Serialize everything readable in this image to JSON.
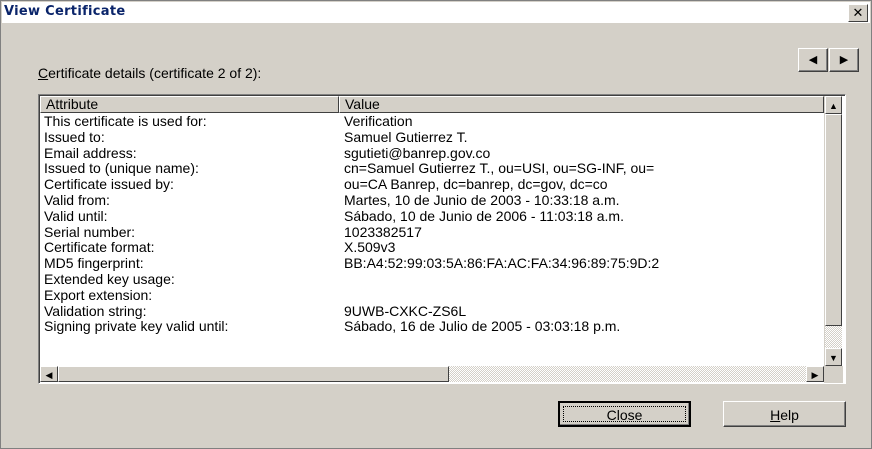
{
  "window": {
    "title": "View Certificate",
    "close_glyph": "✕"
  },
  "details": {
    "label_first": "C",
    "label_rest": "ertificate details (certificate 2 of 2):"
  },
  "nav": {
    "prev_glyph": "◀",
    "next_glyph": "▶"
  },
  "table": {
    "headers": {
      "attribute": "Attribute",
      "value": "Value"
    },
    "rows": [
      {
        "attribute": "This certificate is used for:",
        "value": "Verification"
      },
      {
        "attribute": "Issued to:",
        "value": "Samuel Gutierrez T."
      },
      {
        "attribute": "Email address:",
        "value": "sgutieti@banrep.gov.co"
      },
      {
        "attribute": "Issued to (unique name):",
        "value": "cn=Samuel Gutierrez T., ou=USI, ou=SG-INF, ou="
      },
      {
        "attribute": "Certificate issued by:",
        "value": "ou=CA Banrep, dc=banrep, dc=gov, dc=co"
      },
      {
        "attribute": "Valid from:",
        "value": "Martes, 10 de Junio de 2003 - 10:33:18 a.m."
      },
      {
        "attribute": "Valid until:",
        "value": "Sábado, 10 de Junio de 2006 - 11:03:18 a.m."
      },
      {
        "attribute": "Serial number:",
        "value": "1023382517"
      },
      {
        "attribute": "Certificate format:",
        "value": "X.509v3"
      },
      {
        "attribute": "MD5 fingerprint:",
        "value": "BB:A4:52:99:03:5A:86:FA:AC:FA:34:96:89:75:9D:2"
      },
      {
        "attribute": "Extended key usage:",
        "value": ""
      },
      {
        "attribute": "Export extension:",
        "value": ""
      },
      {
        "attribute": "Validation string:",
        "value": "9UWB-CXKC-ZS6L"
      },
      {
        "attribute": "Signing private key valid until:",
        "value": "Sábado, 16 de Julio de 2005 - 03:03:18 p.m."
      }
    ]
  },
  "scrollbar": {
    "up_glyph": "▲",
    "down_glyph": "▼",
    "left_glyph": "◀",
    "right_glyph": "▶"
  },
  "buttons": {
    "close": "Close",
    "help_first": "H",
    "help_rest": "elp"
  }
}
